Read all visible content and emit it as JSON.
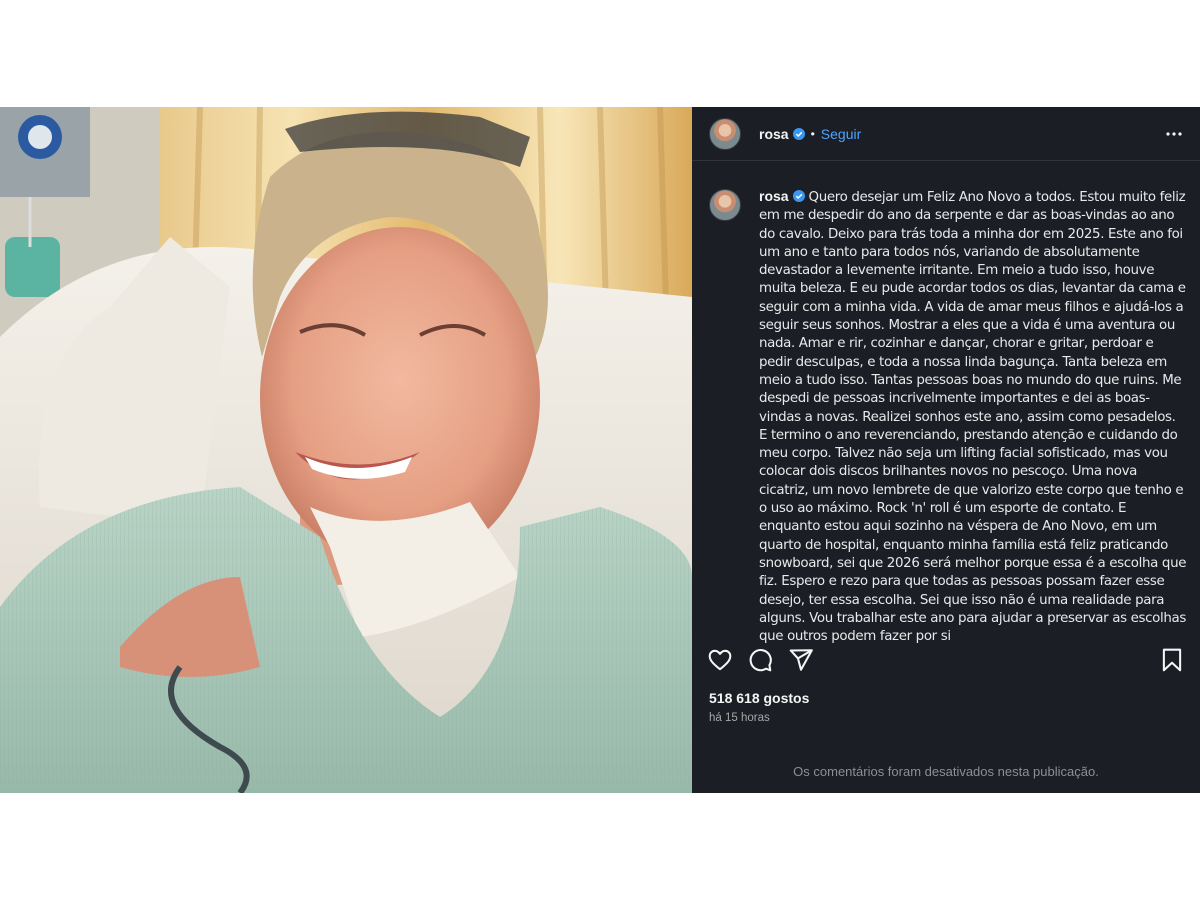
{
  "post": {
    "username": "rosa",
    "separator": "•",
    "follow_label": "Seguir",
    "caption": "Quero desejar um Feliz Ano Novo a todos. Estou muito feliz em me despedir do ano da serpente e dar as boas-vindas ao ano do cavalo. Deixo para trás toda a minha dor em 2025. Este ano foi um ano e tanto para todos nós, variando de absolutamente devastador a levemente irritante. Em meio a tudo isso, houve muita beleza. E eu pude acordar todos os dias, levantar da cama e seguir com a minha vida. A vida de amar meus filhos e ajudá-los a seguir seus sonhos. Mostrar a eles que a vida é uma aventura ou nada. Amar e rir, cozinhar e dançar, chorar e gritar, perdoar e pedir desculpas, e toda a nossa linda bagunça. Tanta beleza em meio a tudo isso. Tantas pessoas boas no mundo do que ruins. Me despedi de pessoas incrivelmente importantes e dei as boas-vindas a novas. Realizei sonhos este ano, assim como pesadelos. E termino o ano reverenciando, prestando atenção e cuidando do meu corpo. Talvez não seja um lifting facial sofisticado, mas vou colocar dois discos brilhantes novos no pescoço. Uma nova cicatriz, um novo lembrete de que valorizo este corpo que tenho e o uso ao máximo. Rock 'n' roll é um esporte de contato. E enquanto estou aqui sozinho na véspera de Ano Novo, em um quarto de hospital, enquanto minha família está feliz praticando snowboard, sei que 2026 será melhor porque essa é a escolha que fiz. Espero e rezo para que todas as pessoas possam fazer esse desejo, ter essa escolha. Sei que isso não é uma realidade para alguns. Vou trabalhar este ano para ajudar a preservar as escolhas que outros podem fazer por si",
    "likes": "518 618 gostos",
    "time_ago": "há 15 horas",
    "comments_disabled": "Os comentários foram desativados nesta publicação."
  },
  "icons": {
    "verified": "verified-badge-icon",
    "more": "more-options-icon",
    "like": "heart-icon",
    "comment": "comment-icon",
    "share": "share-icon",
    "save": "bookmark-icon"
  },
  "colors": {
    "sidebar_bg": "#1c1e26",
    "link_blue": "#4fa3ff",
    "verified_blue": "#3897f0",
    "text": "#f5f5f5",
    "muted": "#8e8e94"
  }
}
